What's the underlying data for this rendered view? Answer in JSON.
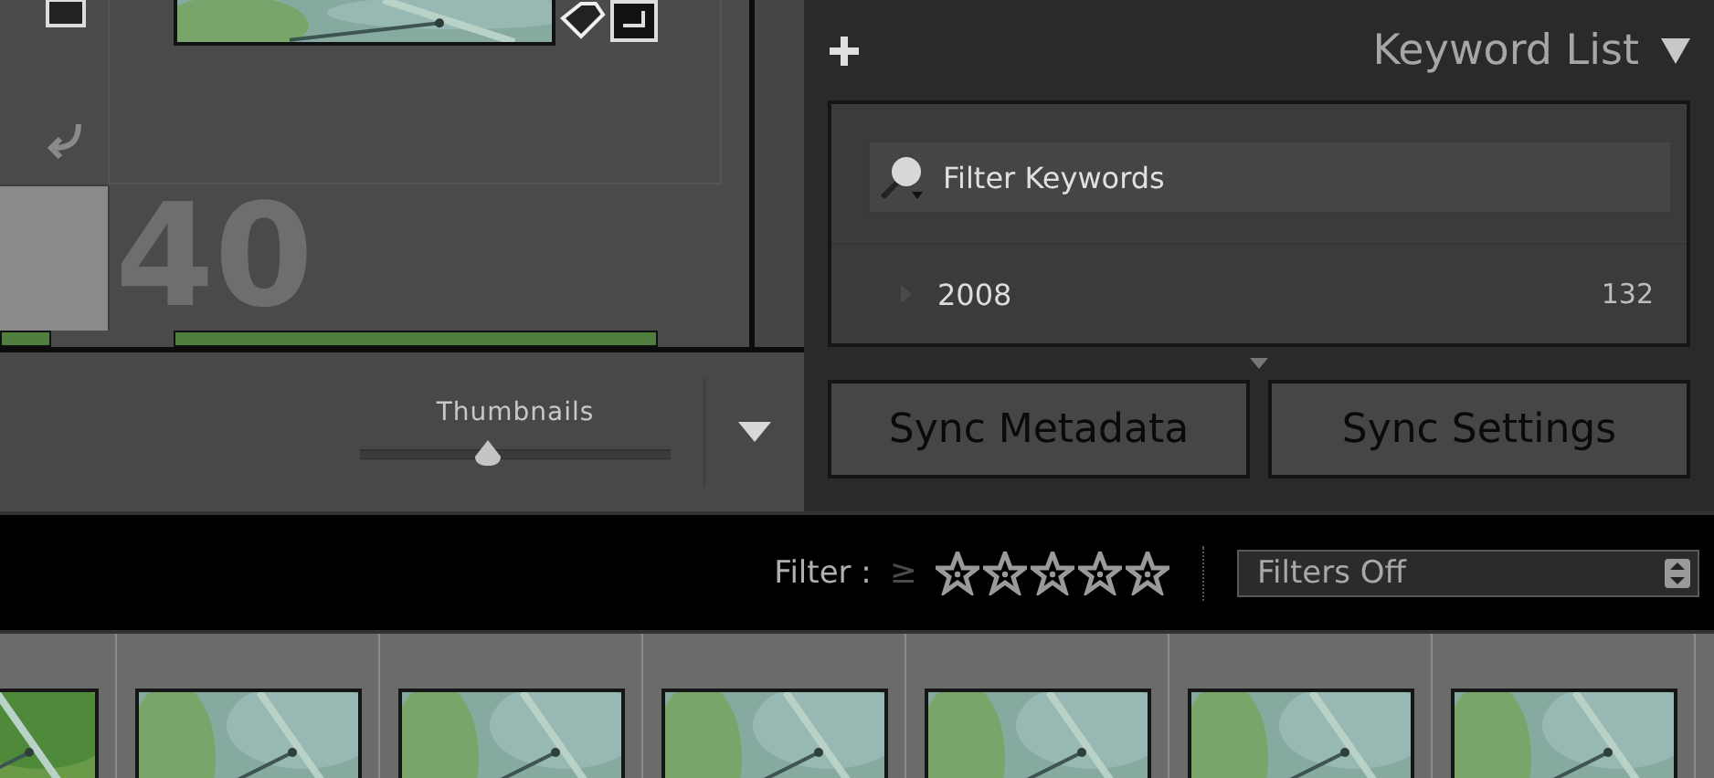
{
  "grid": {
    "cell_number": "40"
  },
  "toolbar": {
    "slider": {
      "label": "Thumbnails",
      "level": 0.41
    }
  },
  "keyword_panel": {
    "title": "Keyword List",
    "filter": {
      "placeholder": "Filter Keywords"
    },
    "keywords": [
      {
        "name": "2008",
        "count": "132"
      }
    ]
  },
  "sync_buttons": [
    "Sync Metadata",
    "Sync Settings"
  ],
  "filter_bar": {
    "label": "Filter :",
    "operator": "≥",
    "stars": 0,
    "dropdown": "Filters Off"
  }
}
